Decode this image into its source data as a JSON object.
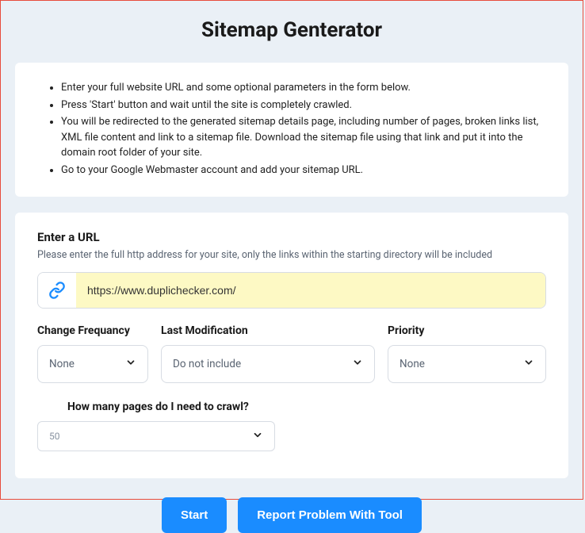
{
  "title": "Sitemap Genterator",
  "instructions": [
    "Enter your full website URL and some optional parameters in the form below.",
    "Press 'Start' button and wait until the site is completely crawled.",
    "You will be redirected to the generated sitemap details page, including number of pages, broken links list, XML file content and link to a sitemap file. Download the sitemap file using that link and put it into the domain root folder of your site.",
    "Go to your Google Webmaster account and add your sitemap URL."
  ],
  "form": {
    "url_heading": "Enter a URL",
    "url_sub": "Please enter the full http address for your site, only the links within the starting directory will be included",
    "url_value": "https://www.duplichecker.com/",
    "change_freq": {
      "label": "Change Frequancy",
      "value": "None"
    },
    "last_mod": {
      "label": "Last Modification",
      "value": "Do not include"
    },
    "priority": {
      "label": "Priority",
      "value": "None"
    },
    "crawl": {
      "label": "How many pages do I need to crawl?",
      "value": "50"
    }
  },
  "buttons": {
    "start": "Start",
    "report": "Report Problem With Tool"
  }
}
